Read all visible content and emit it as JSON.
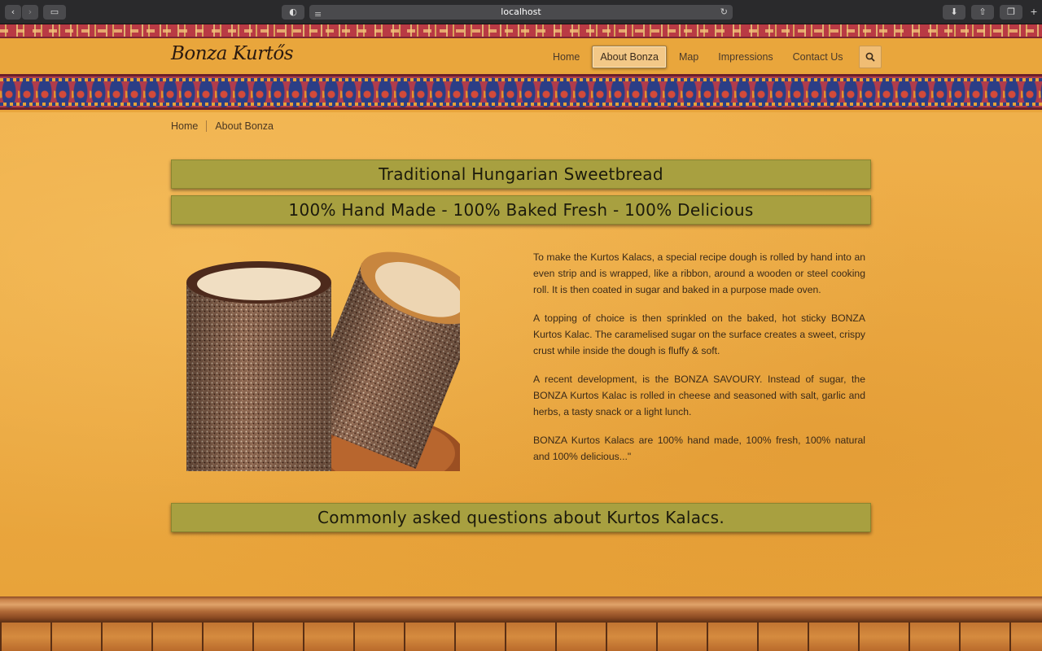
{
  "browser": {
    "url": "localhost"
  },
  "site": {
    "logo": "Bonza Kurtős"
  },
  "nav": {
    "items": [
      {
        "label": "Home"
      },
      {
        "label": "About Bonza"
      },
      {
        "label": "Map"
      },
      {
        "label": "Impressions"
      },
      {
        "label": "Contact Us"
      }
    ],
    "active": "About Bonza"
  },
  "breadcrumb": {
    "home": "Home",
    "current": "About Bonza"
  },
  "banners": {
    "title": "Traditional Hungarian Sweetbread",
    "subtitle": "100% Hand Made - 100% Baked Fresh - 100% Delicious",
    "faq": "Commonly asked questions about Kurtos Kalacs."
  },
  "body": {
    "paragraphs": [
      "To make the Kurtos Kalacs, a special recipe dough is rolled by hand into an even strip and is wrapped, like a ribbon, around a wooden or steel cooking roll. It is then coated in sugar and baked in a purpose made oven.",
      "A topping of choice is then sprinkled on the baked, hot sticky BONZA Kurtos Kalac. The caramelised sugar on the surface creates a sweet, crispy crust while inside the dough is fluffy & soft.",
      "A recent development, is the BONZA SAVOURY. Instead of sugar, the BONZA Kurtos Kalac is rolled in cheese and seasoned with salt, garlic and herbs, a tasty snack or a light lunch.",
      "BONZA Kurtos Kalacs are 100% hand made, 100% fresh, 100% natural and 100% delicious...\""
    ]
  },
  "colors": {
    "banner": "#a8a040",
    "background": "#e9a63c",
    "accent": "#b03c4c"
  }
}
